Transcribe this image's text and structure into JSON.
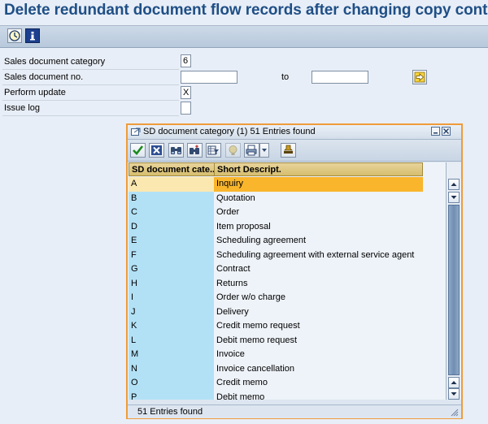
{
  "title": "Delete redundant document flow records after changing copy control",
  "toolbar": {
    "execute_icon": "execute-clock-icon",
    "info_icon": "info-icon"
  },
  "fields": [
    {
      "label": "Sales document category",
      "value": "6"
    },
    {
      "label": "Sales document no.",
      "value": ""
    },
    {
      "label": "Perform update",
      "value": "X"
    },
    {
      "label": "Issue log",
      "value": ""
    }
  ],
  "range": {
    "to_label": "to",
    "to_value": ""
  },
  "popup": {
    "title": "SD document category (1)   51 Entries found",
    "columns": [
      "SD document cate...",
      "Short Descript."
    ],
    "rows": [
      {
        "cat": "A",
        "desc": "Inquiry"
      },
      {
        "cat": "B",
        "desc": "Quotation"
      },
      {
        "cat": "C",
        "desc": "Order"
      },
      {
        "cat": "D",
        "desc": "Item proposal"
      },
      {
        "cat": "E",
        "desc": "Scheduling agreement"
      },
      {
        "cat": "F",
        "desc": "Scheduling agreement with external service agent"
      },
      {
        "cat": "G",
        "desc": "Contract"
      },
      {
        "cat": "H",
        "desc": "Returns"
      },
      {
        "cat": "I",
        "desc": "Order w/o charge"
      },
      {
        "cat": "J",
        "desc": "Delivery"
      },
      {
        "cat": "K",
        "desc": "Credit memo request"
      },
      {
        "cat": "L",
        "desc": "Debit memo request"
      },
      {
        "cat": "M",
        "desc": "Invoice"
      },
      {
        "cat": "N",
        "desc": "Invoice cancellation"
      },
      {
        "cat": "O",
        "desc": "Credit memo"
      },
      {
        "cat": "P",
        "desc": "Debit memo"
      }
    ],
    "status": "51 Entries found"
  },
  "colors": {
    "title": "#1f4f86",
    "selected_row": "#f9b52b",
    "key_column": "#b2e1f6",
    "popup_border": "#ef9b3a"
  }
}
